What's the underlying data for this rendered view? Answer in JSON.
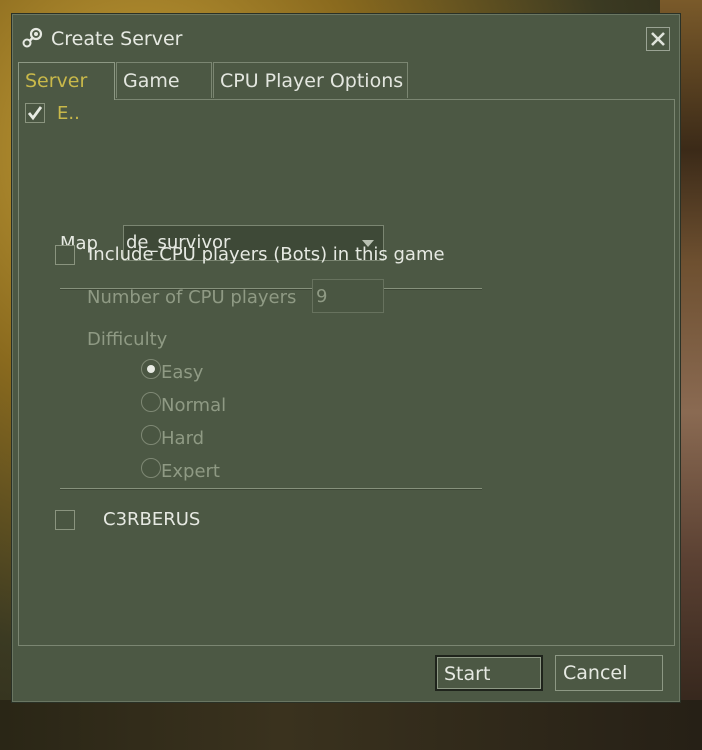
{
  "window": {
    "title": "Create Server"
  },
  "tabs": [
    {
      "label": "Server",
      "active": true
    },
    {
      "label": "Game",
      "active": false
    },
    {
      "label": "CPU Player Options",
      "active": false
    }
  ],
  "server_tab": {
    "top_checkbox_label": "E..",
    "map_label": "Map",
    "map_value": "de_survivor",
    "include_bots_label": "Include CPU players (Bots) in this game",
    "num_cpu_label": "Number of CPU players",
    "num_cpu_value": "9",
    "difficulty_label": "Difficulty",
    "difficulty_options": [
      "Easy",
      "Normal",
      "Hard",
      "Expert"
    ],
    "difficulty_selected": "Easy",
    "c3rberus_label": "C3RBERUS"
  },
  "buttons": {
    "start": "Start",
    "cancel": "Cancel"
  },
  "colors": {
    "window_bg": "#4c5844",
    "active_tab_text": "#c9b94a",
    "text": "#e6e9e2",
    "disabled_text": "#8f9a84"
  }
}
